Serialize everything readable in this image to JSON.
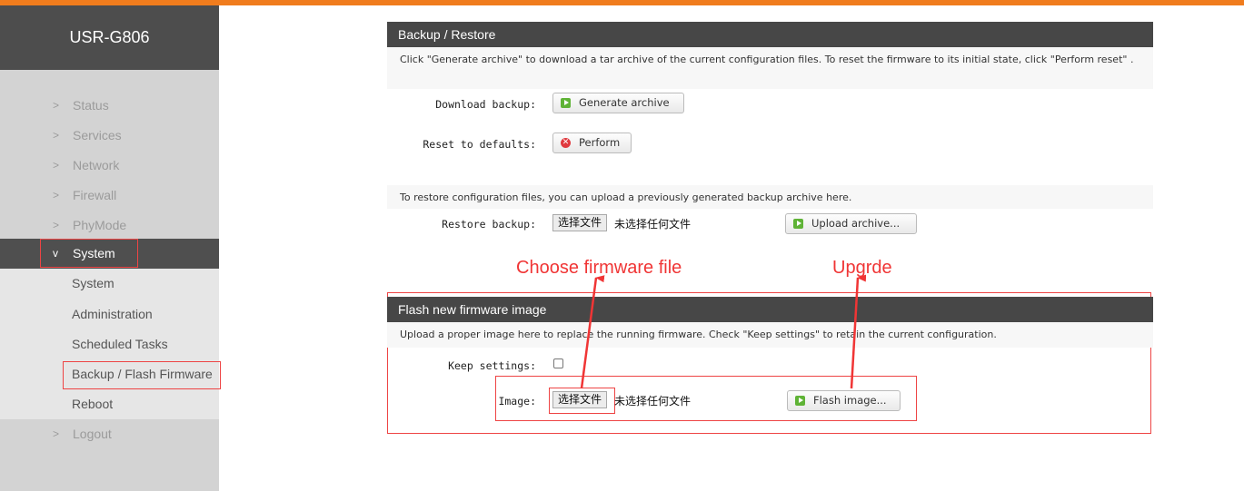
{
  "app": {
    "brand": "USR-G806"
  },
  "sidebar": {
    "items": [
      {
        "label": "Status"
      },
      {
        "label": "Services"
      },
      {
        "label": "Network"
      },
      {
        "label": "Firewall"
      },
      {
        "label": "PhyMode"
      },
      {
        "label": "System"
      },
      {
        "label": "Logout"
      }
    ],
    "chevron_right": ">",
    "chevron_down": "v",
    "sub_items": [
      {
        "label": "System"
      },
      {
        "label": "Administration"
      },
      {
        "label": "Scheduled Tasks"
      },
      {
        "label": "Backup / Flash Firmware"
      },
      {
        "label": "Reboot"
      }
    ]
  },
  "backup": {
    "title": "Backup / Restore",
    "description": "Click \"Generate archive\" to download a tar archive of the current configuration files. To reset the firmware to its initial state, click \"Perform reset\" .",
    "download_label": "Download backup:",
    "generate_button": "Generate archive",
    "reset_label": "Reset to defaults:",
    "perform_button": "Perform",
    "restore_description": "To restore configuration files, you can upload a previously generated backup archive here.",
    "restore_label": "Restore backup:",
    "file_button": "选择文件",
    "file_none": "未选择任何文件",
    "upload_button": "Upload archive..."
  },
  "flash": {
    "title": "Flash new firmware image",
    "description": "Upload a proper image here to replace the running firmware. Check \"Keep settings\" to retain the current configuration.",
    "keep_label": "Keep settings:",
    "keep_checked": false,
    "image_label": "Image:",
    "file_button": "选择文件",
    "file_none": "未选择任何文件",
    "flash_button": "Flash image..."
  },
  "annotations": {
    "choose": "Choose firmware file",
    "upgrade": "Upgrde"
  },
  "colors": {
    "accent": "#f07c1d",
    "annotation": "#f03535",
    "sidebar_active": "#4f4f4f"
  }
}
